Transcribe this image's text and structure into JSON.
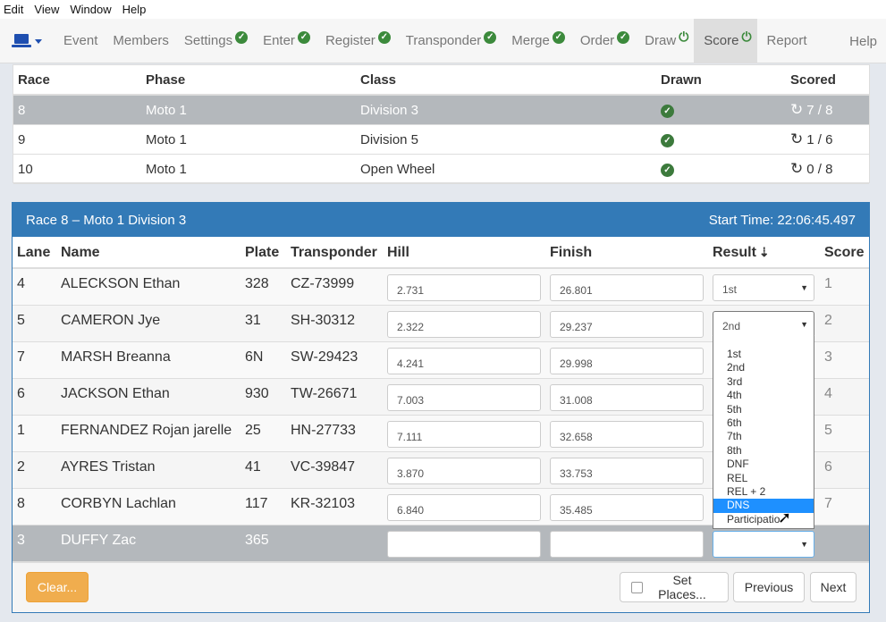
{
  "menubar": [
    "Edit",
    "View",
    "Window",
    "Help"
  ],
  "nav": {
    "items": [
      {
        "label": "Event",
        "badge": ""
      },
      {
        "label": "Members",
        "badge": ""
      },
      {
        "label": "Settings",
        "badge": "check"
      },
      {
        "label": "Enter",
        "badge": "check"
      },
      {
        "label": "Register",
        "badge": "check"
      },
      {
        "label": "Transponder",
        "badge": "check"
      },
      {
        "label": "Merge",
        "badge": "check"
      },
      {
        "label": "Order",
        "badge": "check"
      },
      {
        "label": "Draw",
        "badge": "power"
      },
      {
        "label": "Score",
        "badge": "power"
      },
      {
        "label": "Report",
        "badge": ""
      }
    ],
    "help": "Help"
  },
  "races": {
    "headers": {
      "race": "Race",
      "phase": "Phase",
      "class": "Class",
      "drawn": "Drawn",
      "scored": "Scored"
    },
    "rows": [
      {
        "race": "8",
        "phase": "Moto 1",
        "class": "Division 3",
        "scored": "7 / 8"
      },
      {
        "race": "9",
        "phase": "Moto 1",
        "class": "Division 5",
        "scored": "1 / 6"
      },
      {
        "race": "10",
        "phase": "Moto 1",
        "class": "Open Wheel",
        "scored": "0 / 8"
      }
    ]
  },
  "heat": {
    "title": "Race 8 – Moto 1 Division 3",
    "start_time": "Start Time: 22:06:45.497",
    "headers": {
      "lane": "Lane",
      "name": "Name",
      "plate": "Plate",
      "transponder": "Transponder",
      "hill": "Hill",
      "finish": "Finish",
      "result": "Result",
      "score": "Score"
    },
    "rows": [
      {
        "lane": "4",
        "name": "ALECKSON Ethan",
        "plate": "328",
        "transponder": "CZ-73999",
        "hill": "2.731",
        "finish": "26.801",
        "result": "1st",
        "score": "1"
      },
      {
        "lane": "5",
        "name": "CAMERON Jye",
        "plate": "31",
        "transponder": "SH-30312",
        "hill": "2.322",
        "finish": "29.237",
        "result": "2nd",
        "score": "2"
      },
      {
        "lane": "7",
        "name": "MARSH Breanna",
        "plate": "6N",
        "transponder": "SW-29423",
        "hill": "4.241",
        "finish": "29.998",
        "result": "",
        "score": "3"
      },
      {
        "lane": "6",
        "name": "JACKSON Ethan",
        "plate": "930",
        "transponder": "TW-26671",
        "hill": "7.003",
        "finish": "31.008",
        "result": "",
        "score": "4"
      },
      {
        "lane": "1",
        "name": "FERNANDEZ Rojan jarelle",
        "plate": "25",
        "transponder": "HN-27733",
        "hill": "7.111",
        "finish": "32.658",
        "result": "",
        "score": "5"
      },
      {
        "lane": "2",
        "name": "AYRES Tristan",
        "plate": "41",
        "transponder": "VC-39847",
        "hill": "3.870",
        "finish": "33.753",
        "result": "",
        "score": "6"
      },
      {
        "lane": "8",
        "name": "CORBYN Lachlan",
        "plate": "117",
        "transponder": "KR-32103",
        "hill": "6.840",
        "finish": "35.485",
        "result": "",
        "score": "7"
      },
      {
        "lane": "3",
        "name": "DUFFY Zac",
        "plate": "365",
        "transponder": "",
        "hill": "",
        "finish": "",
        "result": "",
        "score": ""
      }
    ],
    "result_options": [
      "1st",
      "2nd",
      "3rd",
      "4th",
      "5th",
      "6th",
      "7th",
      "8th",
      "DNF",
      "REL",
      "REL + 2",
      "DNS",
      "Participatio"
    ],
    "highlighted_option": "DNS"
  },
  "footer": {
    "clear": "Clear...",
    "set_places": "Set Places...",
    "previous": "Previous",
    "next": "Next"
  }
}
